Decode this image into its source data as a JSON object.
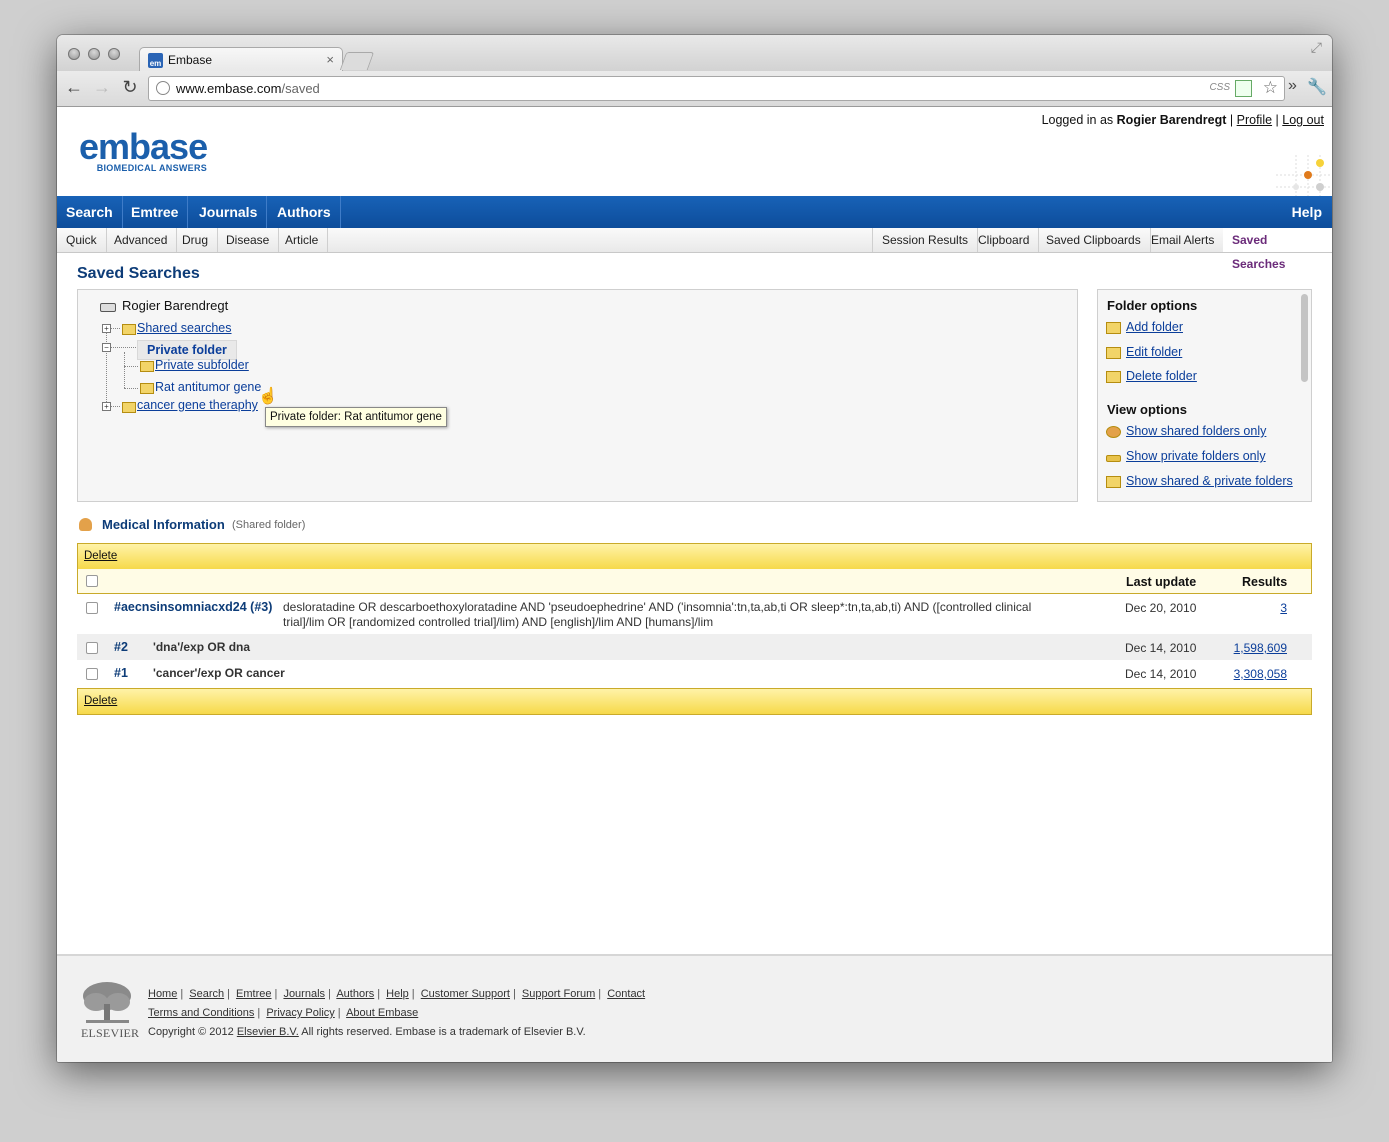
{
  "browser": {
    "tab_title": "Embase",
    "tab_favicon_text": "em",
    "url_host": "www.embase.com",
    "url_path": "/saved",
    "css_label": "CSS"
  },
  "header": {
    "logged_in_prefix": "Logged in as",
    "user_name": "Rogier Barendregt",
    "sep": "|",
    "profile": "Profile",
    "logout": "Log out",
    "logo_word": "embase",
    "logo_tagline": "BIOMEDICAL ANSWERS"
  },
  "main_nav": {
    "items": [
      "Search",
      "Emtree",
      "Journals",
      "Authors"
    ],
    "help": "Help"
  },
  "sub_nav": {
    "left": [
      "Quick",
      "Advanced",
      "Drug",
      "Disease",
      "Article"
    ],
    "right": [
      "Session Results",
      "Clipboard",
      "Saved Clipboards",
      "Email Alerts",
      "Saved Searches"
    ],
    "active": "Saved Searches"
  },
  "page_title": "Saved Searches",
  "tree": {
    "root": "Rogier Barendregt",
    "nodes": {
      "shared": "Shared searches",
      "private": "Private folder",
      "private_sub": "Private subfolder",
      "rat": "Rat antitumor gene",
      "cancer": "cancer gene theraphy"
    },
    "tooltip": "Private folder: Rat antitumor gene"
  },
  "folder_options": {
    "title": "Folder options",
    "add": "Add folder",
    "edit": "Edit folder",
    "delete": "Delete folder"
  },
  "view_options": {
    "title": "View options",
    "shared": "Show shared folders only",
    "private": "Show private folders only",
    "both": "Show shared & private folders"
  },
  "results": {
    "folder_title": "Medical Information",
    "folder_type": "(Shared folder)",
    "delete_label": "Delete",
    "col_last_update": "Last update",
    "col_results": "Results",
    "rows": [
      {
        "id": "#aecnsinsomniacxd24 (#3)",
        "query_line1": "desloratadine OR descarboethoxyloratadine AND 'pseudoephedrine' AND ('insomnia':tn,ta,ab,ti OR sleep*:tn,ta,ab,ti) AND ([controlled clinical",
        "query_line2": "trial]/lim OR [randomized controlled trial]/lim) AND [english]/lim AND [humans]/lim",
        "date": "Dec 20, 2010",
        "results": "3"
      },
      {
        "id": "#2",
        "query_line1": "'dna'/exp OR dna",
        "date": "Dec 14, 2010",
        "results": "1,598,609"
      },
      {
        "id": "#1",
        "query_line1": "'cancer'/exp OR cancer",
        "date": "Dec 14, 2010",
        "results": "3,308,058"
      }
    ]
  },
  "footer": {
    "publisher": "ELSEVIER",
    "links1": [
      "Home",
      "Search",
      "Emtree",
      "Journals",
      "Authors",
      "Help",
      "Customer Support",
      "Support Forum",
      "Contact"
    ],
    "links2": [
      "Terms and Conditions",
      "Privacy Policy",
      "About Embase"
    ],
    "copyright_prefix": "Copyright © 2012",
    "copyright_link": "Elsevier B.V.",
    "copyright_suffix": "All rights reserved. Embase is a trademark of Elsevier B.V.",
    "sep": "|"
  },
  "icons": {
    "folder": "folder-icon",
    "shared_users": "users-icon",
    "key": "key-icon",
    "drive": "drive-icon"
  },
  "colors": {
    "nav_blue": "#0d4d9b",
    "link_blue": "#0b3e9a",
    "title_navy": "#0d3c78",
    "active_tab_purple": "#6b2b7a",
    "delete_bar_yellow": "#f6d94a"
  }
}
